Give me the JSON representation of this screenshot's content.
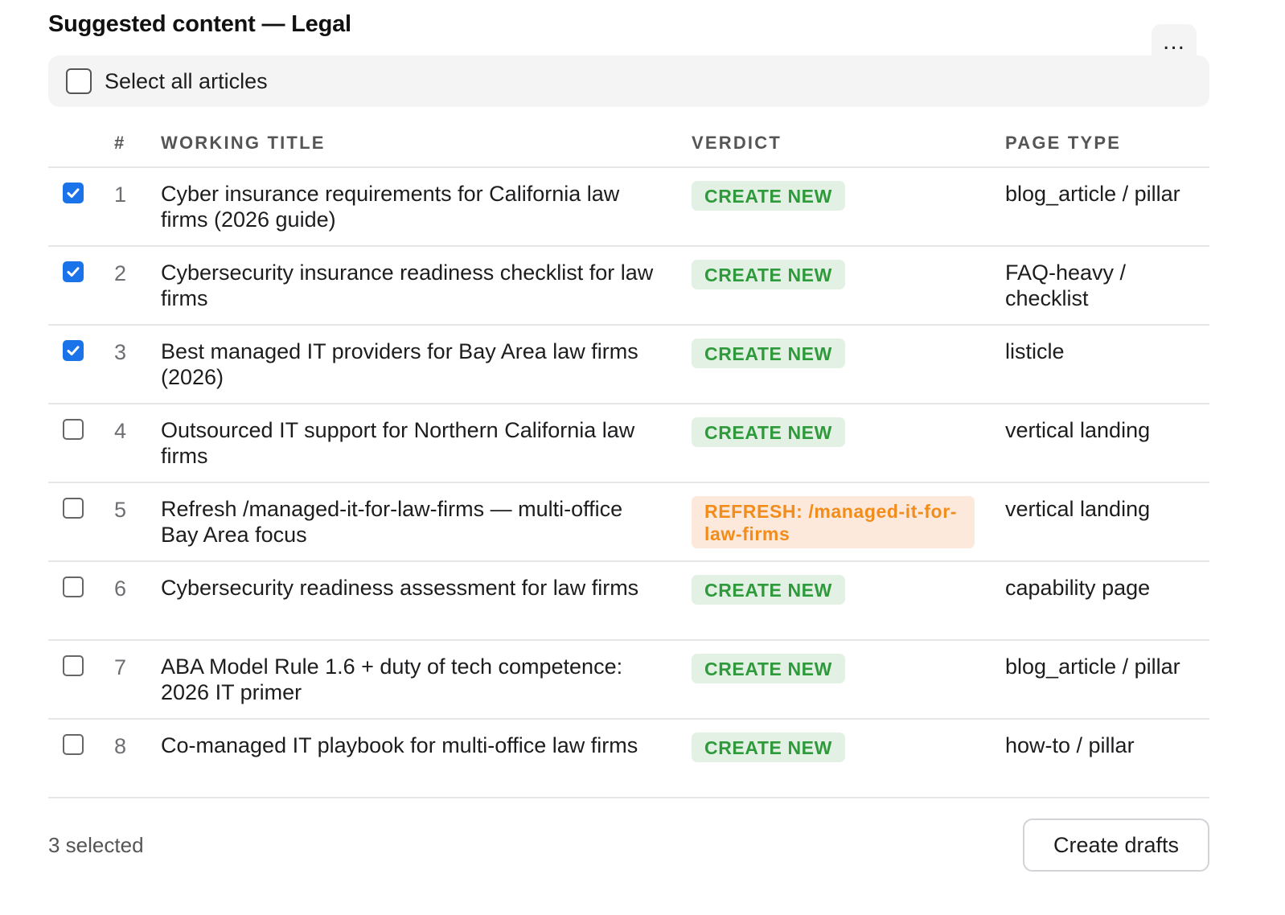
{
  "header": {
    "title": "Suggested content — Legal",
    "more_label": "..."
  },
  "select_all": {
    "label": "Select all articles",
    "checked": false
  },
  "table": {
    "columns": [
      "#",
      "WORKING TITLE",
      "VERDICT",
      "PAGE TYPE"
    ],
    "rows": [
      {
        "num": "1",
        "title": "Cyber insurance requirements for California law firms (2026 guide)",
        "verdict": "CREATE NEW",
        "verdict_kind": "create",
        "page_type": "blog_article / pillar",
        "checked": true
      },
      {
        "num": "2",
        "title": "Cybersecurity insurance readiness checklist for law firms",
        "verdict": "CREATE NEW",
        "verdict_kind": "create",
        "page_type": "FAQ-heavy / checklist",
        "checked": true
      },
      {
        "num": "3",
        "title": "Best managed IT providers for Bay Area law firms (2026)",
        "verdict": "CREATE NEW",
        "verdict_kind": "create",
        "page_type": "listicle",
        "checked": true
      },
      {
        "num": "4",
        "title": "Outsourced IT support for Northern California law firms",
        "verdict": "CREATE NEW",
        "verdict_kind": "create",
        "page_type": "vertical landing",
        "checked": false
      },
      {
        "num": "5",
        "title": "Refresh /managed-it-for-law-firms — multi-office Bay Area focus",
        "verdict": "REFRESH: /managed-it-for-law-firms",
        "verdict_kind": "refresh",
        "page_type": "vertical landing",
        "checked": false
      },
      {
        "num": "6",
        "title": "Cybersecurity readiness assessment for law firms",
        "verdict": "CREATE NEW",
        "verdict_kind": "create",
        "page_type": "capability page",
        "checked": false
      },
      {
        "num": "7",
        "title": "ABA Model Rule 1.6 + duty of tech competence: 2026 IT primer",
        "verdict": "CREATE NEW",
        "verdict_kind": "create",
        "page_type": "blog_article / pillar",
        "checked": false
      },
      {
        "num": "8",
        "title": "Co-managed IT playbook for multi-office law firms",
        "verdict": "CREATE NEW",
        "verdict_kind": "create",
        "page_type": "how-to / pillar",
        "checked": false
      }
    ]
  },
  "footer": {
    "selected_count": "3 selected",
    "create_button": "Create drafts"
  },
  "colors": {
    "checkbox_checked": "#1a73e8",
    "create_badge_bg": "#e3f1e4",
    "create_badge_text": "#2f9a3b",
    "refresh_badge_bg": "#fde8dc",
    "refresh_badge_text": "#f28c1a"
  }
}
